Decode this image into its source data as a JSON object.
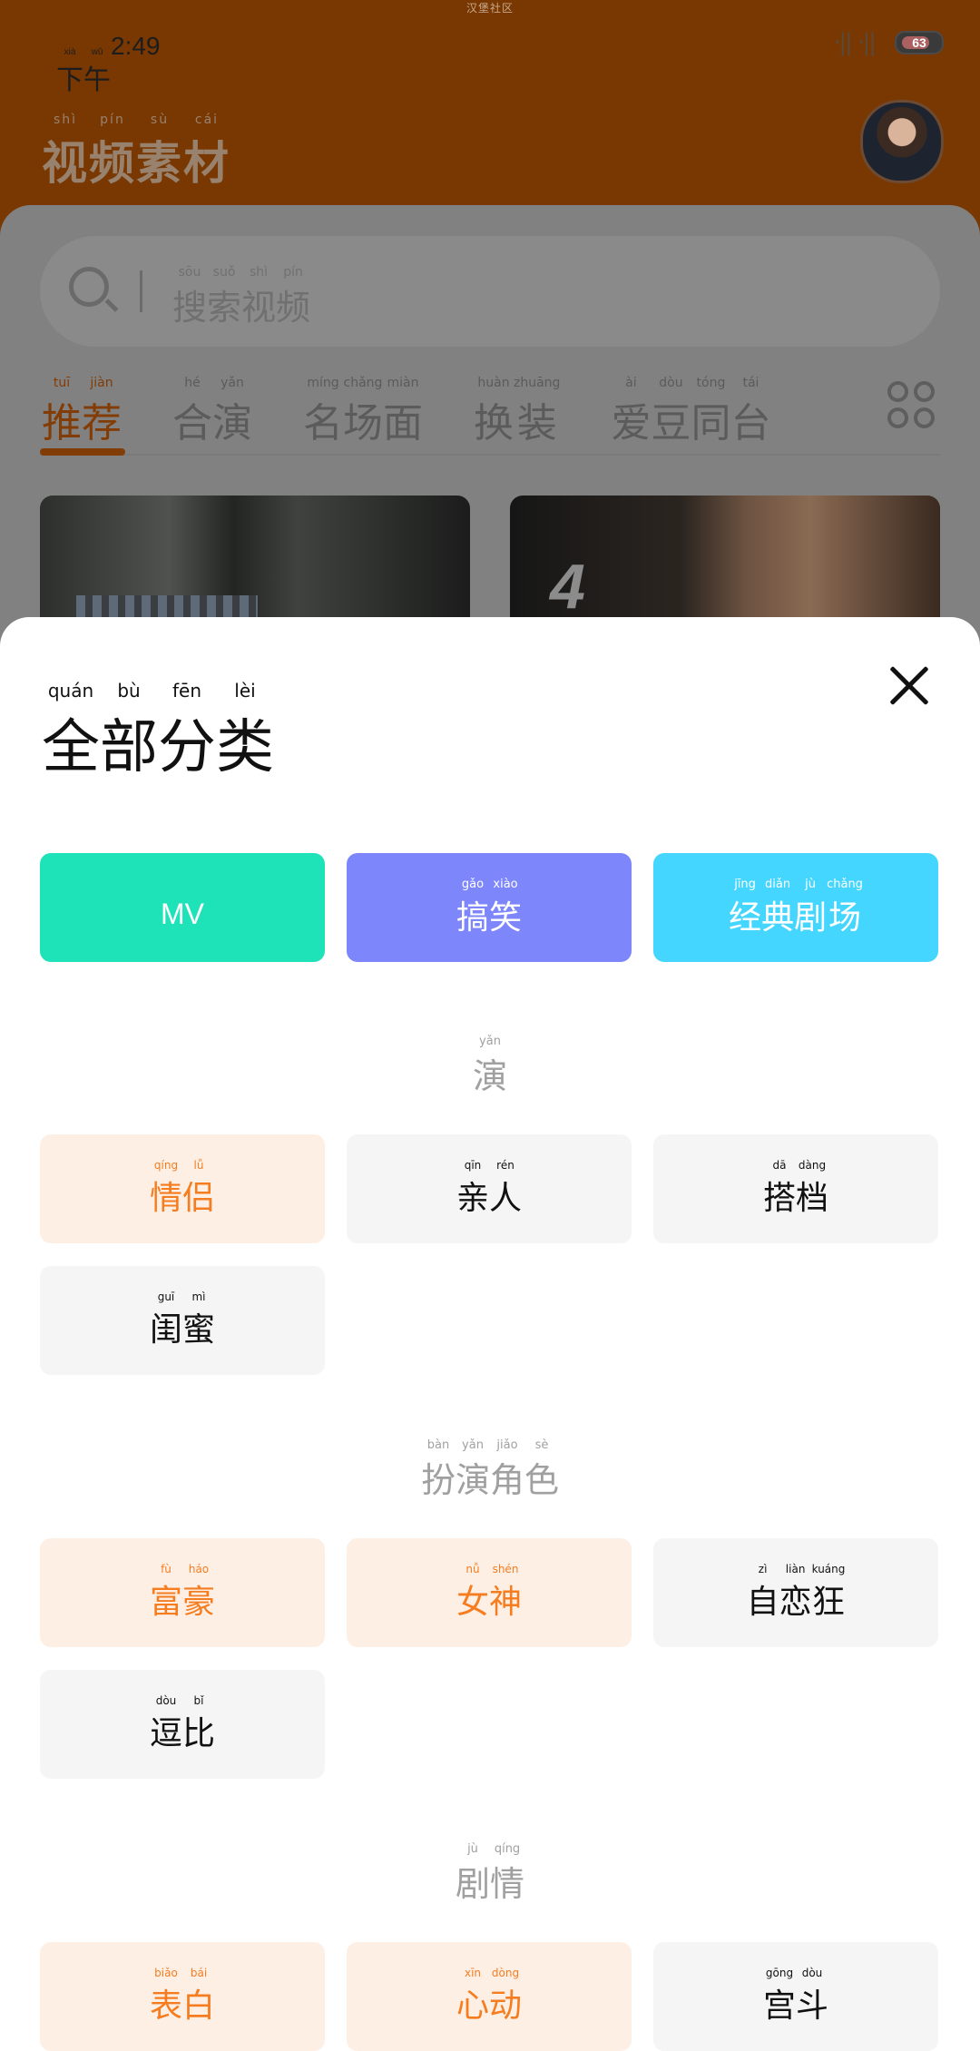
{
  "watermark": "汉堡社区",
  "status_bar": {
    "time_prefix": "下午",
    "time_prefix_pinyin": [
      "xià",
      "wǔ"
    ],
    "time": "2:49",
    "signal_text": "·|| ·||",
    "battery": "63"
  },
  "header": {
    "title": [
      "视",
      "频",
      "素",
      "材"
    ],
    "title_pinyin": [
      "shì",
      "pín",
      "sù",
      "cái"
    ]
  },
  "search": {
    "placeholder": [
      "搜",
      "索",
      "视",
      "频"
    ],
    "placeholder_pinyin": [
      "sōu",
      "suǒ",
      "shì",
      "pín"
    ]
  },
  "tabs": [
    {
      "chars": [
        "推",
        "荐"
      ],
      "pinyin": [
        "tuī",
        "jiàn"
      ],
      "active": true
    },
    {
      "chars": [
        "合",
        "演"
      ],
      "pinyin": [
        "hé",
        "yǎn"
      ]
    },
    {
      "chars": [
        "名",
        "场",
        "面"
      ],
      "pinyin": [
        "míng",
        "chǎng",
        "miàn"
      ]
    },
    {
      "chars": [
        "换",
        "装"
      ],
      "pinyin": [
        "huàn",
        "zhuāng"
      ]
    },
    {
      "chars": [
        "爱",
        "豆",
        "同",
        "台"
      ],
      "pinyin": [
        "ài",
        "dòu",
        "tóng",
        "tái"
      ]
    }
  ],
  "thumbnail_right_text": "4",
  "sheet": {
    "title": [
      "全",
      "部",
      "分",
      "类"
    ],
    "title_pinyin": [
      "quán",
      "bù",
      "fēn",
      "lèi"
    ]
  },
  "featured": [
    {
      "label": "MV",
      "color": "#1ee3b8"
    },
    {
      "chars": [
        "搞",
        "笑"
      ],
      "pinyin": [
        "gǎo",
        "xiào"
      ],
      "color": "#7d86fa"
    },
    {
      "chars": [
        "经",
        "典",
        "剧",
        "场"
      ],
      "pinyin": [
        "jīng",
        "diǎn",
        "jù",
        "chǎng"
      ],
      "color": "#44d6ff"
    }
  ],
  "sections": [
    {
      "title": [
        "演"
      ],
      "title_pinyin": [
        "yǎn"
      ],
      "items": [
        {
          "chars": [
            "情",
            "侣"
          ],
          "pinyin": [
            "qíng",
            "lǚ"
          ],
          "highlighted": true
        },
        {
          "chars": [
            "亲",
            "人"
          ],
          "pinyin": [
            "qīn",
            "rén"
          ],
          "highlighted": false
        },
        {
          "chars": [
            "搭",
            "档"
          ],
          "pinyin": [
            "dā",
            "dàng"
          ],
          "highlighted": false
        },
        {
          "chars": [
            "闺",
            "蜜"
          ],
          "pinyin": [
            "guī",
            "mì"
          ],
          "highlighted": false
        }
      ]
    },
    {
      "title": [
        "扮",
        "演",
        "角",
        "色"
      ],
      "title_pinyin": [
        "bàn",
        "yǎn",
        "jiǎo",
        "sè"
      ],
      "items": [
        {
          "chars": [
            "富",
            "豪"
          ],
          "pinyin": [
            "fù",
            "háo"
          ],
          "highlighted": true
        },
        {
          "chars": [
            "女",
            "神"
          ],
          "pinyin": [
            "nǚ",
            "shén"
          ],
          "highlighted": true
        },
        {
          "chars": [
            "自",
            "恋",
            "狂"
          ],
          "pinyin": [
            "zì",
            "liàn",
            "kuáng"
          ],
          "highlighted": false
        },
        {
          "chars": [
            "逗",
            "比"
          ],
          "pinyin": [
            "dòu",
            "bǐ"
          ],
          "highlighted": false
        }
      ]
    },
    {
      "title": [
        "剧",
        "情"
      ],
      "title_pinyin": [
        "jù",
        "qíng"
      ],
      "items": [
        {
          "chars": [
            "表",
            "白"
          ],
          "pinyin": [
            "biǎo",
            "bái"
          ],
          "highlighted": true
        },
        {
          "chars": [
            "心",
            "动"
          ],
          "pinyin": [
            "xīn",
            "dòng"
          ],
          "highlighted": true
        },
        {
          "chars": [
            "宫",
            "斗"
          ],
          "pinyin": [
            "gōng",
            "dòu"
          ],
          "highlighted": false
        }
      ]
    }
  ],
  "colors": {
    "accent": "#f57d20",
    "highlight_bg": "#feefe5",
    "plain_bg": "#f5f5f5",
    "dim_header": "#793801"
  }
}
